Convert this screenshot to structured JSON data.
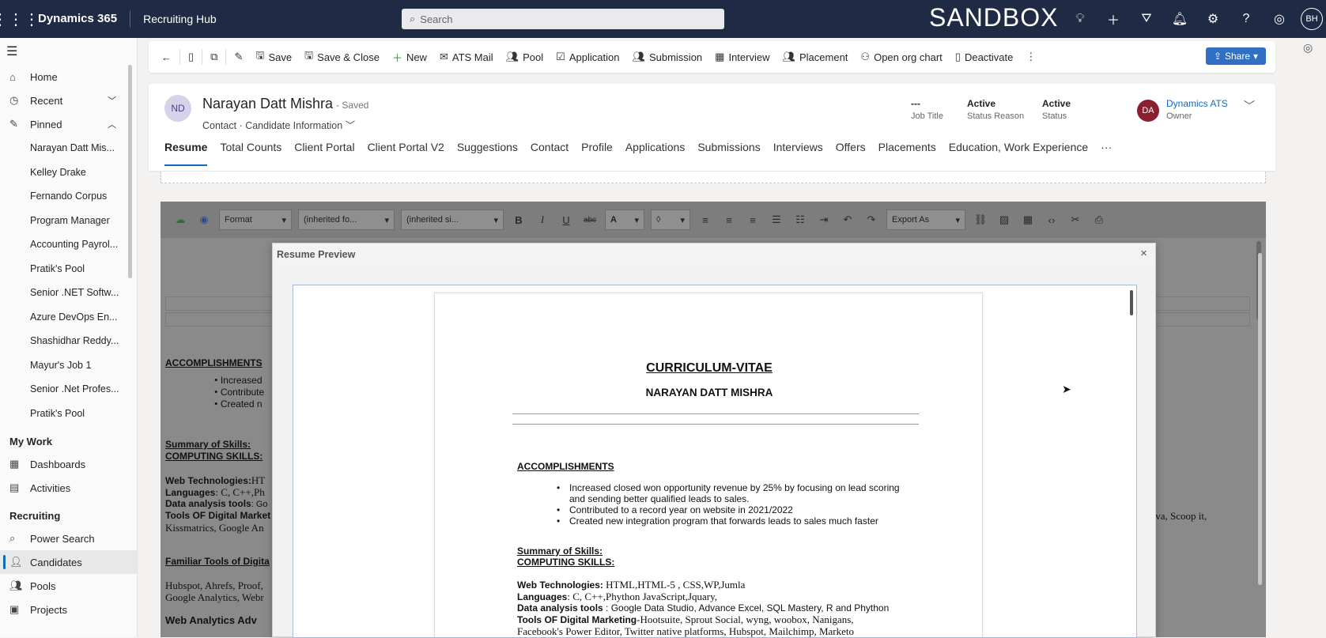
{
  "topbar": {
    "brand": "Dynamics 365",
    "app": "Recruiting Hub",
    "search_placeholder": "Search",
    "environment": "SANDBOX",
    "user_initials": "BH"
  },
  "sidebar": {
    "home": "Home",
    "recent": "Recent",
    "pinned": "Pinned",
    "pinned_items": [
      "Narayan Datt Mis...",
      "Kelley Drake",
      "Fernando Corpus",
      "Program Manager",
      "Accounting Payrol...",
      "Pratik's Pool",
      "Senior .NET Softw...",
      "Azure DevOps En...",
      "Shashidhar Reddy...",
      "Mayur's Job 1",
      "Senior .Net Profes...",
      "Pratik's Pool"
    ],
    "my_work": "My Work",
    "dashboards": "Dashboards",
    "activities": "Activities",
    "recruiting": "Recruiting",
    "power_search": "Power Search",
    "candidates": "Candidates",
    "pools": "Pools",
    "projects": "Projects"
  },
  "commands": {
    "save": "Save",
    "save_close": "Save & Close",
    "new": "New",
    "ats_mail": "ATS Mail",
    "pool": "Pool",
    "application": "Application",
    "submission": "Submission",
    "interview": "Interview",
    "placement": "Placement",
    "open_org_chart": "Open org chart",
    "deactivate": "Deactivate",
    "share": "Share"
  },
  "record": {
    "initials": "ND",
    "name": "Narayan Datt Mishra",
    "saved": "- Saved",
    "entity": "Contact",
    "form": "Candidate Information",
    "job_title_value": "---",
    "job_title_label": "Job Title",
    "status_reason_value": "Active",
    "status_reason_label": "Status Reason",
    "status_value": "Active",
    "status_label": "Status",
    "owner_initials": "DA",
    "owner_value": "Dynamics ATS",
    "owner_label": "Owner"
  },
  "tabs": [
    "Resume",
    "Total Counts",
    "Client Portal",
    "Client Portal V2",
    "Suggestions",
    "Contact",
    "Profile",
    "Applications",
    "Submissions",
    "Interviews",
    "Offers",
    "Placements",
    "Education, Work Experience",
    "···"
  ],
  "editor": {
    "format": "Format",
    "font": "(inherited fo...",
    "size": "(inherited si...",
    "font_color": "A",
    "export": "Export As",
    "accomplishments": "ACCOMPLISHMENTS",
    "bullet1": "Increased",
    "bullet2": "Contribute",
    "bullet3": "Created n",
    "summary": "Summary of Skills:",
    "computing": "COMPUTING SKILLS:",
    "web_label": "Web Technologies:",
    "web_value": "HT",
    "lang_label": "Languages",
    "lang_value": ":  C, C++,Ph",
    "data_label": "Data analysis tools",
    "data_value": ": Go",
    "tools_label": "Tools OF Digital Market",
    "kissmetrics": "Kissmatrics, Google An",
    "right_tail": "anva, Scoop it,",
    "familiar": "Familiar Tools of Digita",
    "hubspot": "Hubspot, Ahrefs, Proof,",
    "ganalytics": "Google Analytics, Webr",
    "web_analytics": "Web Analytics Adv"
  },
  "modal": {
    "title": "Resume Preview",
    "close": "×"
  },
  "resume": {
    "title": "CURRICULUM-VITAE",
    "name": "NARAYAN DATT MISHRA",
    "accomplishments": "ACCOMPLISHMENTS",
    "bullets": [
      "Increased closed won opportunity revenue by 25% by focusing on lead scoring and sending better qualified leads to sales.",
      "Contributed to a record year on website in 2021/2022",
      "Created new integration program that forwards leads to sales much faster"
    ],
    "summary": "Summary of Skills:",
    "computing": "COMPUTING SKILLS:",
    "web_label": "Web Technologies:",
    "web_value": " HTML,HTML-5 , CSS,WP,Jumla",
    "lang_label": "Languages",
    "lang_value": ":  C, C++,Phython JavaScript,Jquary,",
    "data_label": "Data analysis tools",
    "data_value": " : Google Data Studio, Advance Excel, SQL Mastery, R and Phython",
    "tools_label": "Tools OF Digital Marketing",
    "tools_value": "-Hootsuite, Sprout Social, wyng, woobox, Nanigans,",
    "tools_line2": "Facebook's Power Editor, Twitter native platforms, Hubspot, Mailchimp, Marketo"
  }
}
